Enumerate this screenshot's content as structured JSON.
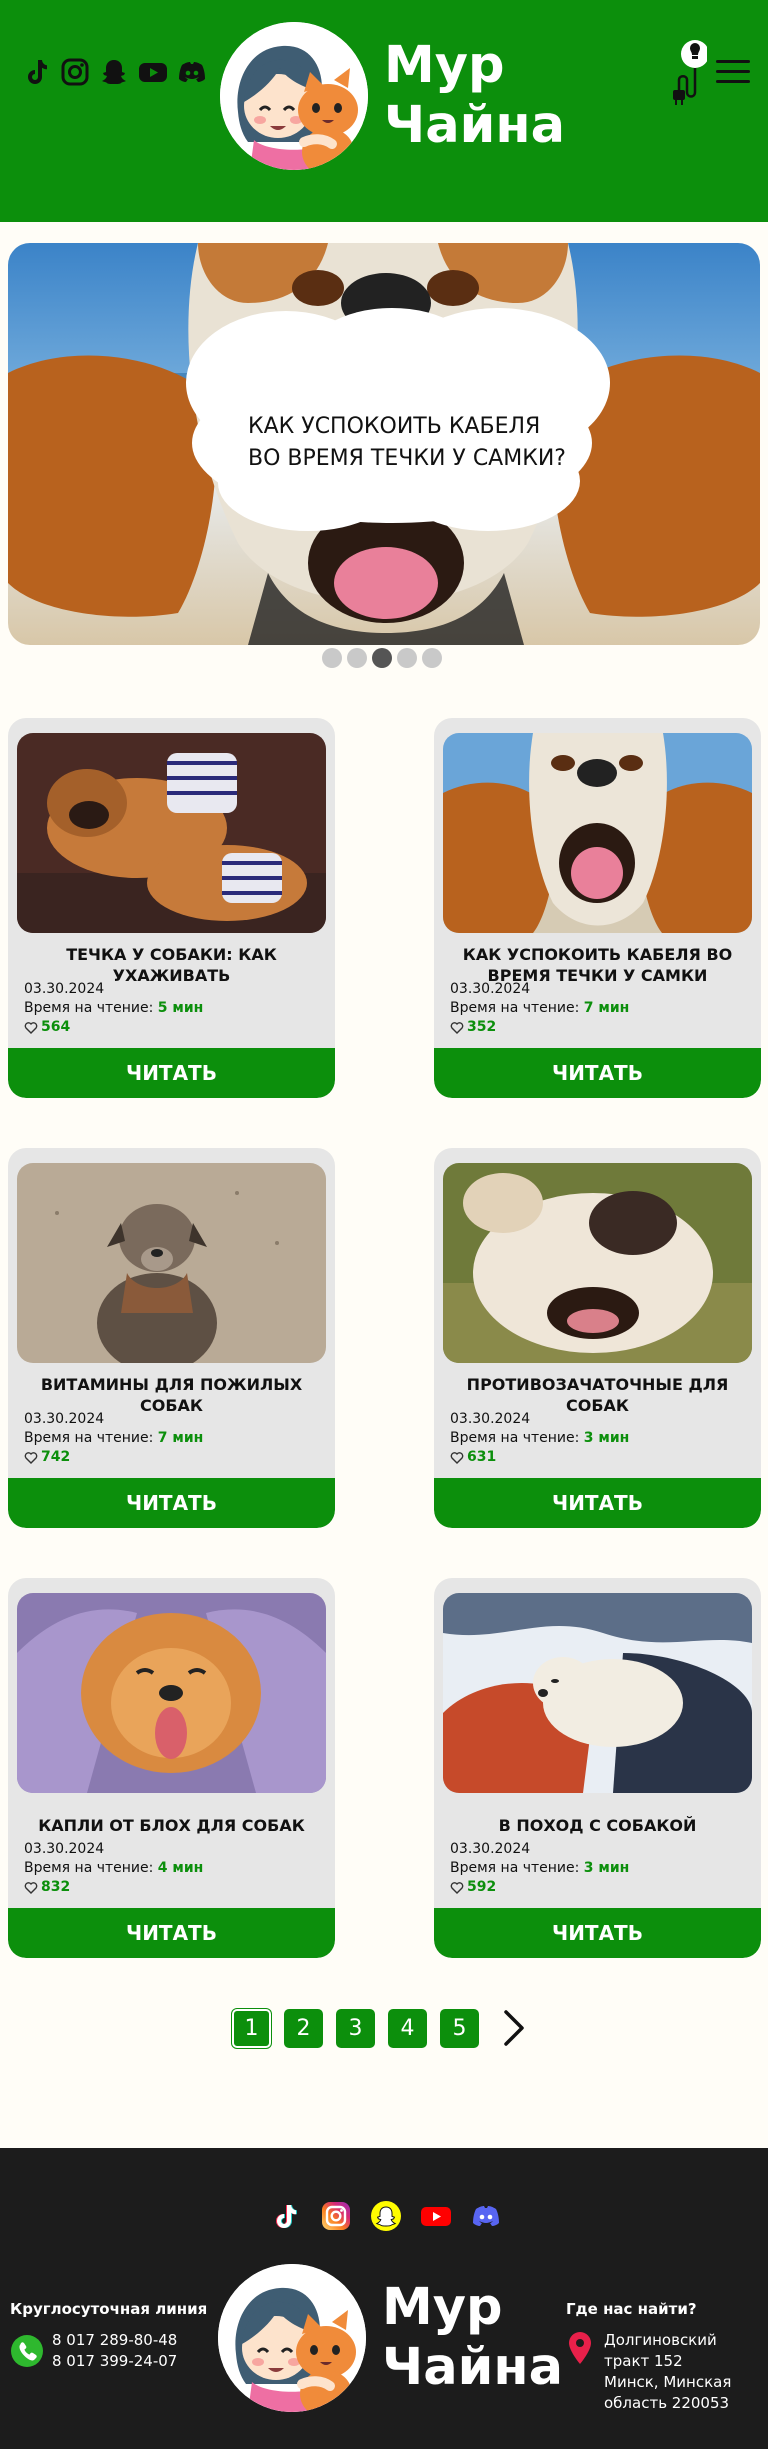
{
  "brand": {
    "line1": "Мур",
    "line2": "Чайна"
  },
  "header": {
    "social": [
      "tiktok-icon",
      "instagram-icon",
      "snapchat-icon",
      "youtube-icon",
      "discord-icon"
    ],
    "menu_icon": "burger-menu-icon",
    "theme_icon": "lamp-toggle-icon"
  },
  "hero": {
    "caption_line1": "КАК УСПОКОИТЬ КАБЕЛЯ",
    "caption_line2": "ВО ВРЕМЯ ТЕЧКИ У САМКИ?",
    "slides": 5,
    "active_slide": 3
  },
  "cards": [
    {
      "title": "ТЕЧКА У СОБАКИ: КАК УХАЖИВАТЬ",
      "date": "03.30.2024",
      "read_label": "Время на чтение:",
      "read_time": "5 мин",
      "likes": "564",
      "button": "ЧИТАТЬ"
    },
    {
      "title": "КАК УСПОКОИТЬ КАБЕЛЯ ВО ВРЕМЯ ТЕЧКИ У САМКИ",
      "date": "03.30.2024",
      "read_label": "Время на чтение:",
      "read_time": "7 мин",
      "likes": "352",
      "button": "ЧИТАТЬ"
    },
    {
      "title": "ВИТАМИНЫ ДЛЯ ПОЖИЛЫХ СОБАК",
      "date": "03.30.2024",
      "read_label": "Время на чтение:",
      "read_time": "7 мин",
      "likes": "742",
      "button": "ЧИТАТЬ"
    },
    {
      "title": "ПРОТИВОЗАЧАТОЧНЫЕ ДЛЯ СОБАК",
      "date": "03.30.2024",
      "read_label": "Время на чтение:",
      "read_time": "3 мин",
      "likes": "631",
      "button": "ЧИТАТЬ"
    },
    {
      "title": "КАПЛИ ОТ БЛОХ ДЛЯ СОБАК",
      "date": "03.30.2024",
      "read_label": "Время на чтение:",
      "read_time": "4 мин",
      "likes": "832",
      "button": "ЧИТАТЬ"
    },
    {
      "title": "В ПОХОД С СОБАКОЙ",
      "date": "03.30.2024",
      "read_label": "Время на чтение:",
      "read_time": "3 мин",
      "likes": "592",
      "button": "ЧИТАТЬ"
    }
  ],
  "pagination": {
    "pages": [
      "1",
      "2",
      "3",
      "4",
      "5"
    ],
    "current": "1",
    "next_icon": "chevron-right-icon"
  },
  "footer": {
    "hotline_title": "Круглосуточная линия",
    "phone1": "8 017 289-80-48",
    "phone2": "8 017 399-24-07",
    "where_title": "Где нас найти?",
    "address_line1": "Долгиновский",
    "address_line2": "тракт 152",
    "address_line3": "Минск, Минская",
    "address_line4": "область 220053"
  },
  "colors": {
    "brand_green": "#0c8f0c",
    "footer_bg": "#1c1c1c",
    "page_bg": "#fffdf7",
    "card_bg": "#e6e6e6"
  }
}
